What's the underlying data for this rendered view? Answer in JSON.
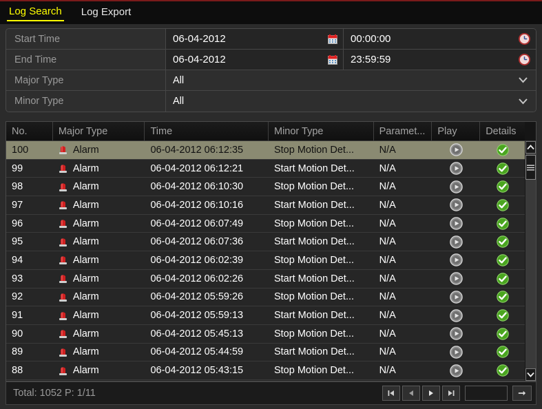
{
  "tabs": [
    {
      "label": "Log Search",
      "active": true
    },
    {
      "label": "Log Export",
      "active": false
    }
  ],
  "colors": {
    "accent_yellow": "#ffff00",
    "selected_row": "#8a8a72",
    "panel_bg": "#2b2b2b",
    "status_green": "#4aa520",
    "alarm_red": "#d02020",
    "top_border": "#7a1a1a"
  },
  "form": {
    "rows": [
      {
        "label": "Start Time",
        "date": "06-04-2012",
        "time": "00:00:00",
        "calendar_icon": "calendar-icon",
        "clock_icon": "clock-icon",
        "type": "datetime"
      },
      {
        "label": "End Time",
        "date": "06-04-2012",
        "time": "23:59:59",
        "calendar_icon": "calendar-icon",
        "clock_icon": "clock-icon",
        "type": "datetime"
      },
      {
        "label": "Major Type",
        "value": "All",
        "chevron_icon": "chevron-down-icon",
        "type": "select"
      },
      {
        "label": "Minor Type",
        "value": "All",
        "chevron_icon": "chevron-down-icon",
        "type": "select"
      }
    ]
  },
  "table": {
    "headers": [
      "No.",
      "Major Type",
      "Time",
      "Minor Type",
      "Paramet...",
      "Play",
      "Details"
    ],
    "rows": [
      {
        "no": "100",
        "major": "Alarm",
        "time": "06-04-2012 06:12:35",
        "minor": "Stop Motion Det...",
        "param": "N/A",
        "selected": true
      },
      {
        "no": "99",
        "major": "Alarm",
        "time": "06-04-2012 06:12:21",
        "minor": "Start Motion Det...",
        "param": "N/A",
        "selected": false
      },
      {
        "no": "98",
        "major": "Alarm",
        "time": "06-04-2012 06:10:30",
        "minor": "Stop Motion Det...",
        "param": "N/A",
        "selected": false
      },
      {
        "no": "97",
        "major": "Alarm",
        "time": "06-04-2012 06:10:16",
        "minor": "Start Motion Det...",
        "param": "N/A",
        "selected": false
      },
      {
        "no": "96",
        "major": "Alarm",
        "time": "06-04-2012 06:07:49",
        "minor": "Stop Motion Det...",
        "param": "N/A",
        "selected": false
      },
      {
        "no": "95",
        "major": "Alarm",
        "time": "06-04-2012 06:07:36",
        "minor": "Start Motion Det...",
        "param": "N/A",
        "selected": false
      },
      {
        "no": "94",
        "major": "Alarm",
        "time": "06-04-2012 06:02:39",
        "minor": "Stop Motion Det...",
        "param": "N/A",
        "selected": false
      },
      {
        "no": "93",
        "major": "Alarm",
        "time": "06-04-2012 06:02:26",
        "minor": "Start Motion Det...",
        "param": "N/A",
        "selected": false
      },
      {
        "no": "92",
        "major": "Alarm",
        "time": "06-04-2012 05:59:26",
        "minor": "Stop Motion Det...",
        "param": "N/A",
        "selected": false
      },
      {
        "no": "91",
        "major": "Alarm",
        "time": "06-04-2012 05:59:13",
        "minor": "Start Motion Det...",
        "param": "N/A",
        "selected": false
      },
      {
        "no": "90",
        "major": "Alarm",
        "time": "06-04-2012 05:45:13",
        "minor": "Stop Motion Det...",
        "param": "N/A",
        "selected": false
      },
      {
        "no": "89",
        "major": "Alarm",
        "time": "06-04-2012 05:44:59",
        "minor": "Start Motion Det...",
        "param": "N/A",
        "selected": false
      },
      {
        "no": "88",
        "major": "Alarm",
        "time": "06-04-2012 05:43:15",
        "minor": "Stop Motion Det...",
        "param": "N/A",
        "selected": false
      }
    ],
    "row_icons": {
      "major_icon": "alarm-siren-icon",
      "play_icon": "play-circle-icon",
      "details_icon": "check-circle-icon"
    },
    "scrollbar": {
      "up_icon": "chevron-up-icon",
      "down_icon": "chevron-down-icon",
      "thumb_icon": "scroll-thumb-grip"
    }
  },
  "footer": {
    "total_label": "Total: 1052  P: 1/11",
    "page_input_value": "",
    "buttons": [
      {
        "name": "first-page-button",
        "icon": "skip-to-start-icon"
      },
      {
        "name": "prev-page-button",
        "icon": "prev-triangle-icon"
      },
      {
        "name": "next-page-button",
        "icon": "next-triangle-icon"
      },
      {
        "name": "last-page-button",
        "icon": "skip-to-end-icon"
      }
    ],
    "go_button_icon": "arrow-right-icon"
  }
}
